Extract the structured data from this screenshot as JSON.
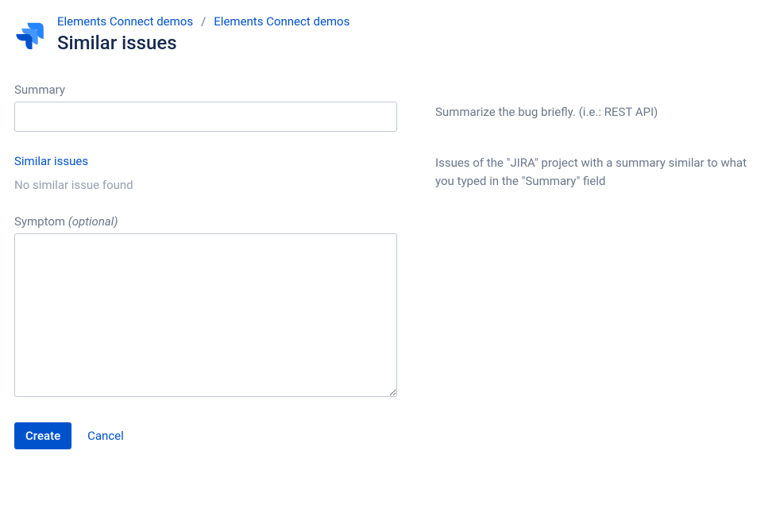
{
  "breadcrumb": {
    "items": [
      "Elements Connect demos",
      "Elements Connect demos"
    ],
    "separator": "/"
  },
  "page_title": "Similar issues",
  "fields": {
    "summary": {
      "label": "Summary",
      "value": "",
      "help": "Summarize the bug briefly. (i.e.: REST API)"
    },
    "similar": {
      "label": "Similar issues",
      "empty_text": "No similar issue found",
      "help": "Issues of the \"JIRA\" project with a summary similar to what you typed in the \"Summary\" field"
    },
    "symptom": {
      "label": "Symptom ",
      "optional_text": "(optional)",
      "value": ""
    }
  },
  "actions": {
    "create": "Create",
    "cancel": "Cancel"
  }
}
